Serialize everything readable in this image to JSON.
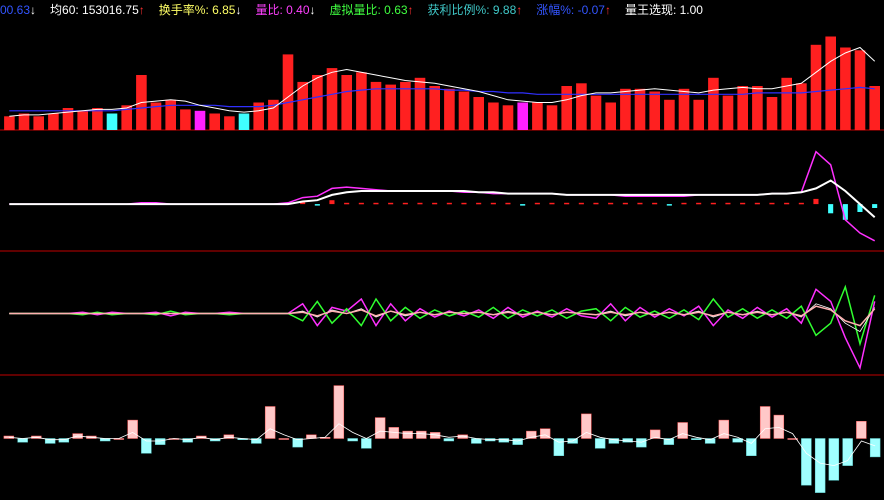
{
  "header": {
    "items": [
      {
        "label": "00.63",
        "arrow": "↓",
        "label_color": "#3355ff",
        "arrow_color": "#ffffff"
      },
      {
        "label": "均60: 153016.75",
        "arrow": "↑",
        "label_color": "#ffffff",
        "arrow_color": "#ff3030"
      },
      {
        "label": "换手率%: 6.85",
        "arrow": "↓",
        "label_color": "#ffff66",
        "arrow_color": "#ffffff"
      },
      {
        "label": "量比: 0.40",
        "arrow": "↓",
        "label_color": "#ff40ff",
        "arrow_color": "#ffffff"
      },
      {
        "label": "虚拟量比: 0.63",
        "arrow": "↑",
        "label_color": "#40ff40",
        "arrow_color": "#ff3030"
      },
      {
        "label": "获利比例%: 9.88",
        "arrow": "↑",
        "label_color": "#40c8c8",
        "arrow_color": "#ff3030"
      },
      {
        "label": "涨幅%: -0.07",
        "arrow": "↑",
        "label_color": "#3355ff",
        "arrow_color": "#ff3030"
      },
      {
        "label": "量王选现: 1.00",
        "arrow": "",
        "label_color": "#ffffff",
        "arrow_color": "#ffffff"
      }
    ]
  },
  "colors": {
    "background": "#000000",
    "separator": "#c00000",
    "up": "#ff2020",
    "down": "#40ffff",
    "special": "#ff20ff",
    "white": "#ffffff",
    "blue_line": "#3030ff",
    "magenta": "#ff30ff",
    "green": "#30ff30",
    "pink": "#ffb0b0",
    "light_pink": "#ffc8c8",
    "light_cyan": "#a0ffff"
  },
  "chart_data": [
    {
      "type": "bar",
      "panel": "volume",
      "categories_count": 60,
      "values": [
        10,
        12,
        10,
        12,
        16,
        14,
        16,
        12,
        18,
        40,
        20,
        22,
        15,
        14,
        12,
        10,
        12,
        20,
        22,
        55,
        35,
        40,
        45,
        40,
        42,
        35,
        33,
        35,
        38,
        32,
        30,
        28,
        24,
        20,
        18,
        20,
        20,
        18,
        32,
        34,
        25,
        20,
        30,
        30,
        28,
        22,
        30,
        22,
        38,
        25,
        32,
        32,
        24,
        38,
        34,
        62,
        68,
        60,
        58,
        32
      ],
      "colors": [
        "up",
        "up",
        "up",
        "up",
        "up",
        "up",
        "up",
        "down",
        "up",
        "up",
        "up",
        "up",
        "up",
        "special",
        "up",
        "up",
        "down",
        "up",
        "up",
        "up",
        "up",
        "up",
        "up",
        "up",
        "up",
        "up",
        "up",
        "up",
        "up",
        "up",
        "up",
        "up",
        "up",
        "up",
        "up",
        "special",
        "up",
        "up",
        "up",
        "up",
        "up",
        "up",
        "up",
        "up",
        "up",
        "up",
        "up",
        "up",
        "up",
        "up",
        "up",
        "up",
        "up",
        "up",
        "up",
        "up",
        "up",
        "up",
        "up",
        "up"
      ],
      "ma_short": [
        10,
        11,
        11,
        12,
        13,
        14,
        15,
        15,
        16,
        20,
        21,
        22,
        21,
        18,
        16,
        14,
        13,
        14,
        16,
        24,
        32,
        38,
        42,
        44,
        42,
        40,
        38,
        36,
        35,
        34,
        32,
        30,
        28,
        25,
        22,
        21,
        20,
        20,
        22,
        25,
        27,
        27,
        28,
        29,
        30,
        29,
        28,
        27,
        29,
        30,
        31,
        30,
        30,
        32,
        34,
        42,
        50,
        56,
        60,
        50
      ],
      "ma_long": [
        14,
        14,
        14,
        14,
        14,
        14,
        14,
        14,
        15,
        16,
        17,
        18,
        18,
        18,
        18,
        17,
        17,
        17,
        18,
        20,
        22,
        24,
        26,
        28,
        29,
        30,
        30,
        30,
        30,
        30,
        29,
        29,
        28,
        28,
        27,
        27,
        26,
        26,
        26,
        26,
        26,
        26,
        26,
        26,
        26,
        26,
        26,
        26,
        26,
        26,
        26,
        27,
        27,
        27,
        27,
        28,
        29,
        30,
        31,
        30
      ],
      "ylim": [
        0,
        80
      ]
    },
    {
      "type": "line",
      "panel": "indicator_2",
      "series": [
        {
          "color": "magenta",
          "values": [
            0,
            0,
            0,
            0,
            0,
            0,
            0,
            0,
            0,
            1,
            1,
            0,
            0,
            0,
            0,
            0,
            0,
            0,
            0,
            1,
            5,
            6,
            12,
            13,
            12,
            11,
            10,
            10,
            10,
            10,
            10,
            9,
            9,
            8,
            8,
            8,
            8,
            8,
            7,
            7,
            7,
            7,
            6,
            6,
            6,
            6,
            6,
            7,
            7,
            7,
            7,
            7,
            8,
            8,
            9,
            40,
            30,
            -12,
            -22,
            -28
          ]
        },
        {
          "color": "white",
          "values": [
            0,
            0,
            0,
            0,
            0,
            0,
            0,
            0,
            0,
            0,
            0,
            0,
            0,
            0,
            0,
            0,
            0,
            0,
            0,
            0,
            2,
            3,
            7,
            9,
            10,
            10,
            10,
            10,
            10,
            10,
            10,
            10,
            9,
            9,
            8,
            8,
            8,
            8,
            7,
            7,
            7,
            7,
            7,
            7,
            7,
            7,
            7,
            7,
            7,
            7,
            7,
            7,
            8,
            8,
            9,
            12,
            18,
            10,
            0,
            -10
          ]
        }
      ],
      "bars": [
        0,
        0,
        0,
        0,
        0,
        0,
        0,
        0,
        0,
        0,
        0,
        0,
        0,
        0,
        0,
        0,
        0,
        0,
        0,
        0,
        2,
        -1,
        3,
        1,
        1,
        1,
        1,
        1,
        1,
        1,
        1,
        1,
        1,
        1,
        1,
        -1,
        1,
        1,
        1,
        1,
        1,
        1,
        1,
        1,
        1,
        -1,
        1,
        1,
        1,
        1,
        1,
        1,
        1,
        1,
        1,
        4,
        -7,
        -12,
        -6,
        -3
      ],
      "ylim": [
        -35,
        55
      ]
    },
    {
      "type": "line",
      "panel": "indicator_3",
      "series": [
        {
          "color": "magenta",
          "values": [
            0,
            0,
            0,
            0,
            0,
            1,
            -1,
            1,
            0,
            0,
            1,
            -2,
            1,
            0,
            0,
            1,
            0,
            0,
            0,
            0,
            8,
            -10,
            5,
            2,
            12,
            -10,
            8,
            -6,
            4,
            -3,
            2,
            -2,
            3,
            -4,
            5,
            -3,
            2,
            -3,
            4,
            -2,
            -4,
            8,
            -6,
            5,
            -3,
            4,
            -2,
            6,
            -10,
            3,
            -4,
            5,
            -3,
            4,
            -8,
            20,
            10,
            -20,
            -45,
            10
          ]
        },
        {
          "color": "green",
          "values": [
            0,
            0,
            0,
            0,
            0,
            -1,
            1,
            -1,
            0,
            0,
            -1,
            2,
            -1,
            0,
            0,
            -1,
            0,
            0,
            0,
            0,
            -6,
            10,
            -8,
            4,
            -10,
            12,
            -6,
            5,
            -4,
            3,
            -2,
            2,
            -3,
            5,
            -4,
            3,
            -2,
            3,
            -4,
            2,
            4,
            -6,
            5,
            -3,
            2,
            -4,
            3,
            -5,
            12,
            -3,
            4,
            -4,
            3,
            -4,
            6,
            -18,
            -8,
            22,
            -25,
            15
          ]
        },
        {
          "color": "white",
          "values": [
            0,
            0,
            0,
            0,
            0,
            0,
            0,
            0,
            0,
            0,
            0,
            0,
            0,
            0,
            0,
            0,
            0,
            0,
            0,
            0,
            2,
            -3,
            3,
            0,
            4,
            -3,
            2,
            -2,
            1,
            -1,
            1,
            0,
            1,
            -1,
            2,
            -1,
            1,
            -1,
            1,
            0,
            -1,
            2,
            -2,
            1,
            -1,
            1,
            -1,
            2,
            -3,
            1,
            -1,
            2,
            -1,
            1,
            -3,
            8,
            4,
            -8,
            -15,
            5
          ]
        },
        {
          "color": "pink",
          "values": [
            0,
            0,
            0,
            0,
            0,
            0,
            0,
            0,
            0,
            0,
            0,
            0,
            0,
            0,
            0,
            0,
            0,
            0,
            0,
            0,
            1,
            -2,
            2,
            0,
            3,
            -2,
            2,
            -1,
            1,
            -1,
            1,
            0,
            1,
            -1,
            1,
            -1,
            1,
            -1,
            1,
            0,
            -1,
            1,
            -1,
            1,
            -1,
            1,
            -1,
            1,
            -2,
            1,
            -1,
            1,
            -1,
            1,
            -2,
            6,
            3,
            -6,
            -10,
            4
          ]
        }
      ],
      "ylim": [
        -50,
        50
      ]
    },
    {
      "type": "bar",
      "panel": "indicator_4",
      "values": [
        2,
        -3,
        2,
        -4,
        -3,
        4,
        2,
        -2,
        0,
        15,
        -12,
        -5,
        0,
        -3,
        2,
        -2,
        3,
        -1,
        -4,
        26,
        0,
        -7,
        3,
        1,
        43,
        -2,
        -8,
        17,
        9,
        6,
        6,
        5,
        -2,
        3,
        -4,
        -2,
        -3,
        -5,
        6,
        8,
        -14,
        -4,
        20,
        -8,
        -4,
        -3,
        -7,
        7,
        -5,
        13,
        -1,
        -4,
        15,
        -3,
        -14,
        26,
        19,
        0,
        -38,
        -44,
        -34,
        -22,
        14,
        -15
      ],
      "line": [
        1,
        0,
        1,
        -1,
        -1,
        2,
        1,
        0,
        0,
        5,
        -2,
        -2,
        0,
        -1,
        1,
        -1,
        1,
        0,
        -1,
        8,
        3,
        -1,
        0,
        1,
        12,
        5,
        0,
        6,
        5,
        4,
        4,
        3,
        1,
        2,
        0,
        -1,
        -1,
        -2,
        1,
        3,
        -3,
        -2,
        5,
        1,
        -1,
        -2,
        -3,
        1,
        -1,
        4,
        1,
        -1,
        4,
        1,
        -4,
        8,
        9,
        4,
        -12,
        -20,
        -22,
        -18,
        -2,
        -6
      ],
      "ylim": [
        -50,
        50
      ]
    }
  ]
}
